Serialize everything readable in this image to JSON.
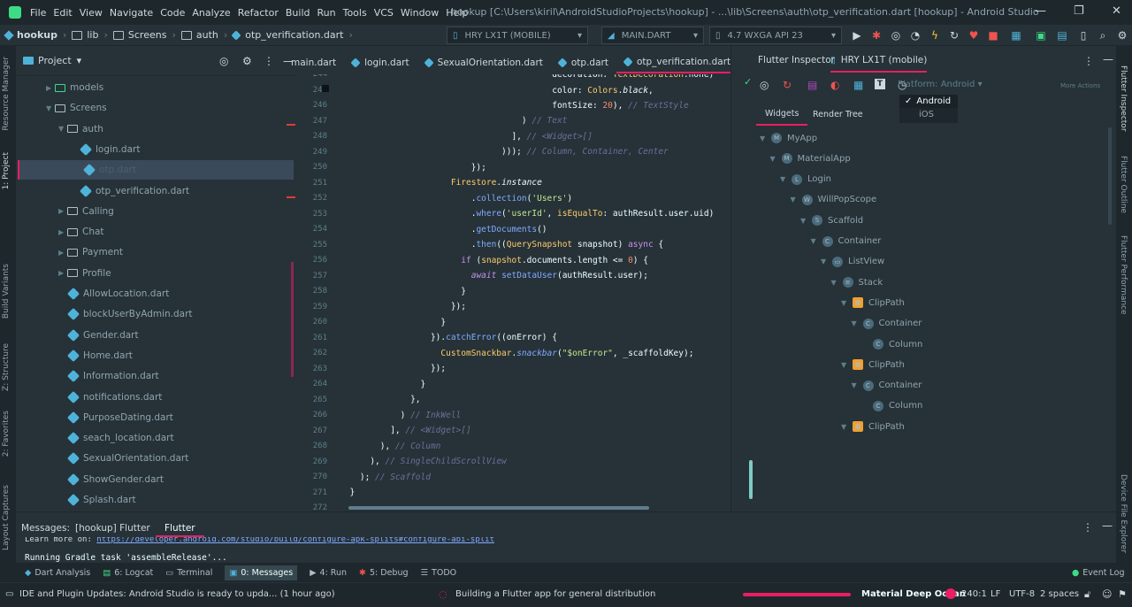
{
  "menu": [
    "File",
    "Edit",
    "View",
    "Navigate",
    "Code",
    "Analyze",
    "Refactor",
    "Build",
    "Run",
    "Tools",
    "VCS",
    "Window",
    "Help"
  ],
  "window_title": "hookup [C:\\Users\\kiril\\AndroidStudioProjects\\hookup] - ...\\lib\\Screens\\auth\\otp_verification.dart [hookup] - Android Studio",
  "breadcrumb": [
    "hookup",
    "lib",
    "Screens",
    "auth",
    "otp_verification.dart"
  ],
  "toolbar": {
    "device": "HRY LX1T (MOBILE)",
    "config": "MAIN.DART",
    "emulator": "4.7  WXGA API 23"
  },
  "left_stripe": [
    "Resource Manager",
    "1: Project",
    "Build Variants",
    "Z: Structure",
    "2: Favorites",
    "Layout Captures"
  ],
  "right_stripe": [
    "Flutter Inspector",
    "Flutter Outline",
    "Flutter Performance",
    "Device File Explorer"
  ],
  "project": {
    "title": "Project",
    "items": [
      {
        "label": "models",
        "type": "folder",
        "depth": 1,
        "arrow": "▶"
      },
      {
        "label": "Screens",
        "type": "folder",
        "depth": 1,
        "arrow": "▼"
      },
      {
        "label": "auth",
        "type": "folder",
        "depth": 2,
        "arrow": "▼"
      },
      {
        "label": "login.dart",
        "type": "dart",
        "depth": 3,
        "arrow": ""
      },
      {
        "label": "otp.dart",
        "type": "dart",
        "depth": 3,
        "arrow": "",
        "selected": true
      },
      {
        "label": "otp_verification.dart",
        "type": "dart",
        "depth": 3,
        "arrow": ""
      },
      {
        "label": "Calling",
        "type": "folder",
        "depth": 2,
        "arrow": "▶"
      },
      {
        "label": "Chat",
        "type": "folder",
        "depth": 2,
        "arrow": "▶"
      },
      {
        "label": "Payment",
        "type": "folder",
        "depth": 2,
        "arrow": "▶"
      },
      {
        "label": "Profile",
        "type": "folder",
        "depth": 2,
        "arrow": "▶"
      },
      {
        "label": "AllowLocation.dart",
        "type": "dart",
        "depth": 2,
        "arrow": ""
      },
      {
        "label": "blockUserByAdmin.dart",
        "type": "dart",
        "depth": 2,
        "arrow": ""
      },
      {
        "label": "Gender.dart",
        "type": "dart",
        "depth": 2,
        "arrow": ""
      },
      {
        "label": "Home.dart",
        "type": "dart",
        "depth": 2,
        "arrow": ""
      },
      {
        "label": "Information.dart",
        "type": "dart",
        "depth": 2,
        "arrow": ""
      },
      {
        "label": "notifications.dart",
        "type": "dart",
        "depth": 2,
        "arrow": ""
      },
      {
        "label": "PurposeDating.dart",
        "type": "dart",
        "depth": 2,
        "arrow": ""
      },
      {
        "label": "seach_location.dart",
        "type": "dart",
        "depth": 2,
        "arrow": ""
      },
      {
        "label": "SexualOrientation.dart",
        "type": "dart",
        "depth": 2,
        "arrow": ""
      },
      {
        "label": "ShowGender.dart",
        "type": "dart",
        "depth": 2,
        "arrow": ""
      },
      {
        "label": "Splash.dart",
        "type": "dart",
        "depth": 2,
        "arrow": ""
      }
    ]
  },
  "editor_tabs": [
    {
      "label": "main.dart",
      "active": false
    },
    {
      "label": "login.dart",
      "active": false
    },
    {
      "label": "SexualOrientation.dart",
      "active": false
    },
    {
      "label": "otp.dart",
      "active": false
    },
    {
      "label": "otp_verification.dart",
      "active": true
    }
  ],
  "line_numbers": [
    "244",
    "245",
    "246",
    "247",
    "248",
    "249",
    "250",
    "251",
    "252",
    "253",
    "254",
    "255",
    "256",
    "257",
    "258",
    "259",
    "260",
    "261",
    "262",
    "263",
    "264",
    "265",
    "266",
    "267",
    "268",
    "269",
    "270",
    "271",
    "272"
  ],
  "inspector": {
    "tab_title": "Flutter Inspector",
    "device_tab": "HRY LX1T (mobile)",
    "platform_label": "Platform: Android",
    "more_actions": "More Actions",
    "platform_options": [
      "Android",
      "iOS"
    ],
    "sub_tabs": [
      "Widgets",
      "Render Tree"
    ],
    "tree": [
      {
        "label": "MyApp",
        "depth": 0,
        "badge": "M"
      },
      {
        "label": "MaterialApp",
        "depth": 1,
        "badge": "M"
      },
      {
        "label": "Login",
        "depth": 2,
        "badge": "L"
      },
      {
        "label": "WillPopScope",
        "depth": 3,
        "badge": "W"
      },
      {
        "label": "Scaffold",
        "depth": 4,
        "badge": "S"
      },
      {
        "label": "Container",
        "depth": 5,
        "badge": "C"
      },
      {
        "label": "ListView",
        "depth": 6,
        "badge": "▭"
      },
      {
        "label": "Stack",
        "depth": 7,
        "badge": "≡"
      },
      {
        "label": "ClipPath",
        "depth": 8,
        "badge": "▦"
      },
      {
        "label": "Container",
        "depth": 9,
        "badge": "C"
      },
      {
        "label": "Column",
        "depth": 10,
        "badge": "C"
      },
      {
        "label": "ClipPath",
        "depth": 8,
        "badge": "▦"
      },
      {
        "label": "Container",
        "depth": 9,
        "badge": "C"
      },
      {
        "label": "Column",
        "depth": 10,
        "badge": "C"
      },
      {
        "label": "ClipPath",
        "depth": 8,
        "badge": "▦"
      }
    ]
  },
  "messages": {
    "label": "Messages:",
    "tabs": [
      "[hookup] Flutter",
      "Flutter"
    ],
    "line1_prefix": "Learn more on: ",
    "line1_link": "https://developer.android.com/studio/build/configure-apk-splits#configure-abi-split",
    "line2": "Running Gradle task 'assembleRelease'..."
  },
  "tool_windows": [
    "Dart Analysis",
    "6: Logcat",
    "Terminal",
    "0: Messages",
    "4: Run",
    "5: Debug",
    "TODO"
  ],
  "event_log": "Event Log",
  "status": {
    "left": "IDE and Plugin Updates: Android Studio is ready to upda... (1 hour ago)",
    "center": "Building a Flutter app for general distribution",
    "theme": "Material Deep Ocean",
    "position": "240:1",
    "line_sep": "LF",
    "encoding": "UTF-8",
    "indent": "2 spaces"
  },
  "colors": {
    "accent": "#e91e63",
    "bg": "#263238",
    "dart": "#4fb3d9"
  }
}
